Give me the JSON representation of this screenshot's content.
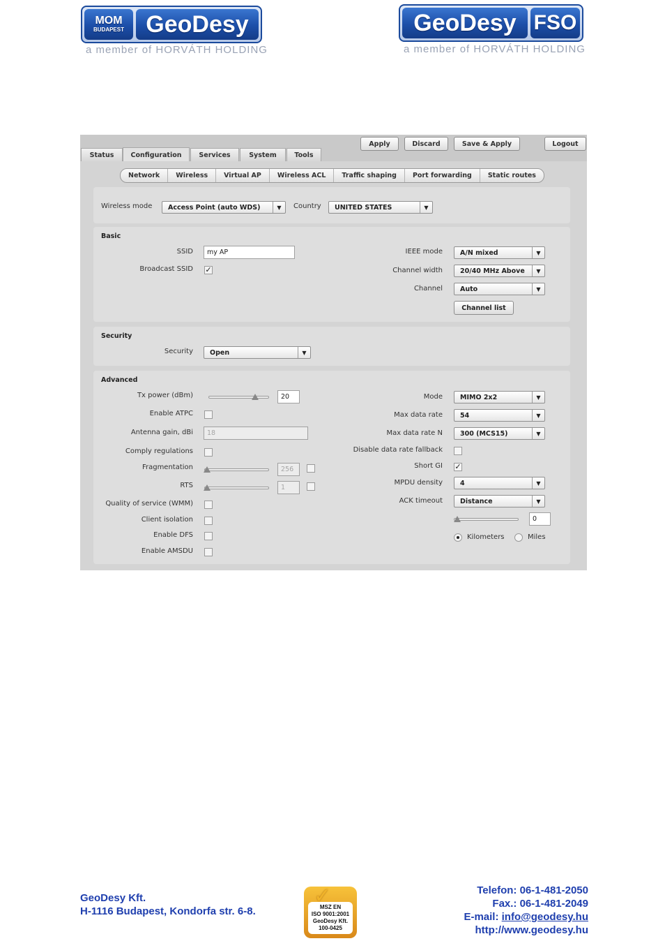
{
  "header": {
    "left_logo": {
      "badge_top": "MOM",
      "badge_bottom": "BUDAPEST",
      "brand": "GeoDesy",
      "subtitle": "a member of HORVÁTH HOLDING"
    },
    "right_logo": {
      "brand": "GeoDesy",
      "badge": "FSO",
      "subtitle": "a member of HORVÁTH HOLDING"
    }
  },
  "ui": {
    "top_tabs": [
      "Status",
      "Configuration",
      "Services",
      "System",
      "Tools"
    ],
    "active_tab": "Configuration",
    "buttons": {
      "apply": "Apply",
      "discard": "Discard",
      "save_apply": "Save & Apply",
      "logout": "Logout"
    },
    "sub_tabs": [
      "Network",
      "Wireless",
      "Virtual AP",
      "Wireless ACL",
      "Traffic shaping",
      "Port forwarding",
      "Static routes"
    ],
    "wireless_mode": {
      "label": "Wireless mode",
      "value": "Access Point (auto WDS)"
    },
    "country": {
      "label": "Country",
      "value": "UNITED STATES"
    },
    "basic": {
      "title": "Basic",
      "ssid_label": "SSID",
      "ssid_value": "my AP",
      "broadcast_label": "Broadcast SSID",
      "broadcast_checked": true,
      "ieee_label": "IEEE mode",
      "ieee_value": "A/N mixed",
      "width_label": "Channel width",
      "width_value": "20/40 MHz Above",
      "channel_label": "Channel",
      "channel_value": "Auto",
      "channel_list": "Channel list"
    },
    "security": {
      "title": "Security",
      "label": "Security",
      "value": "Open"
    },
    "advanced": {
      "title": "Advanced",
      "tx_label": "Tx power (dBm)",
      "tx_value": "20",
      "atpc_label": "Enable ATPC",
      "antenna_label": "Antenna gain, dBi",
      "antenna_value": "18",
      "comply_label": "Comply regulations",
      "frag_label": "Fragmentation",
      "frag_value": "256",
      "rts_label": "RTS",
      "rts_value": "1",
      "qos_label": "Quality of service (WMM)",
      "client_label": "Client isolation",
      "dfs_label": "Enable DFS",
      "amsdu_label": "Enable AMSDU",
      "mode_label": "Mode",
      "mode_value": "MIMO 2x2",
      "max_rate_label": "Max data rate",
      "max_rate_value": "54",
      "max_rate_n_label": "Max data rate N",
      "max_rate_n_value": "300 (MCS15)",
      "fallback_label": "Disable data rate fallback",
      "short_gi_label": "Short GI",
      "short_gi_checked": true,
      "mpdu_label": "MPDU density",
      "mpdu_value": "4",
      "ack_label": "ACK timeout",
      "ack_value": "Distance",
      "distance_value": "0",
      "km_label": "Kilometers",
      "miles_label": "Miles"
    }
  },
  "footer": {
    "company": "GeoDesy Kft.",
    "address": "H-1116 Budapest, Kondorfa str. 6-8.",
    "cert_lines": [
      "MSZ EN",
      "ISO 9001:2001",
      "GeoDesy Kft.",
      "100-0425"
    ],
    "phone": "Telefon: 06-1-481-2050",
    "fax": "Fax.: 06-1-481-2049",
    "email_label": "E-mail: ",
    "email": "info@geodesy.hu",
    "web": "http://www.geodesy.hu"
  }
}
